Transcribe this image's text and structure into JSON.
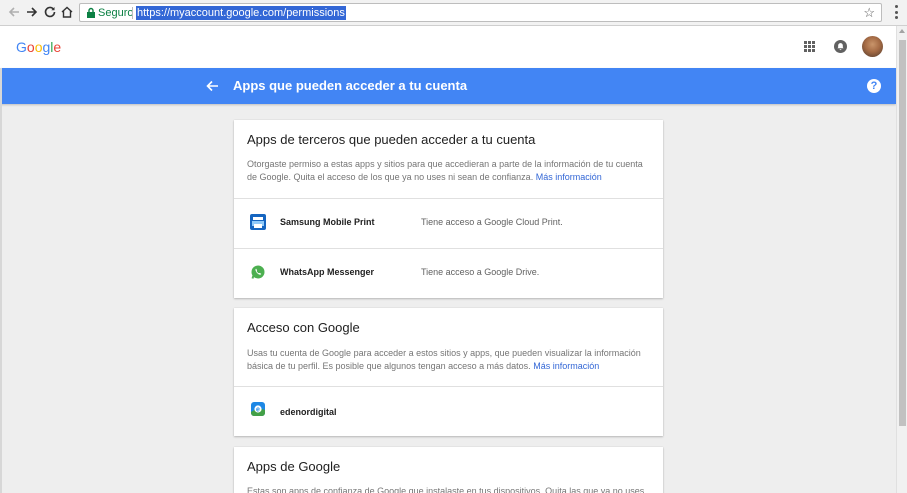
{
  "browser": {
    "secure_label": "Seguro",
    "url": "https://myaccount.google.com/permissions"
  },
  "header": {
    "logo_letters": [
      {
        "char": "G",
        "color": "#4285f4"
      },
      {
        "char": "o",
        "color": "#ea4335"
      },
      {
        "char": "o",
        "color": "#fbbc05"
      },
      {
        "char": "g",
        "color": "#4285f4"
      },
      {
        "char": "l",
        "color": "#34a853"
      },
      {
        "char": "e",
        "color": "#ea4335"
      }
    ],
    "icons": [
      "apps-grid-icon",
      "notifications-icon",
      "avatar"
    ]
  },
  "bar": {
    "title": "Apps que pueden acceder a tu cuenta",
    "help": "?",
    "color": "#4285f4"
  },
  "third_party": {
    "title": "Apps de terceros que pueden acceder a tu cuenta",
    "desc": "Otorgaste permiso a estas apps y sitios para que accedieran a parte de la información de tu cuenta de Google. Quita el acceso de los que ya no uses ni sean de confianza.",
    "link": "Más información",
    "apps": [
      {
        "name": "Samsung Mobile Print",
        "access": "Tiene acceso a Google Cloud Print.",
        "icon": "samsung-print-icon"
      },
      {
        "name": "WhatsApp Messenger",
        "access": "Tiene acceso a Google Drive.",
        "icon": "whatsapp-icon"
      }
    ]
  },
  "sign_in": {
    "title": "Acceso con Google",
    "desc": "Usas tu cuenta de Google para acceder a estos sitios y apps, que pueden visualizar la información básica de tu perfil. Es posible que algunos tengan acceso a más datos.",
    "link": "Más información",
    "apps": [
      {
        "name": "edenordigital",
        "icon": "edenordigital-icon"
      }
    ]
  },
  "google_apps": {
    "title": "Apps de Google",
    "desc": "Estas son apps de confianza de Google que instalaste en tus dispositivos. Quita las que ya no uses"
  }
}
